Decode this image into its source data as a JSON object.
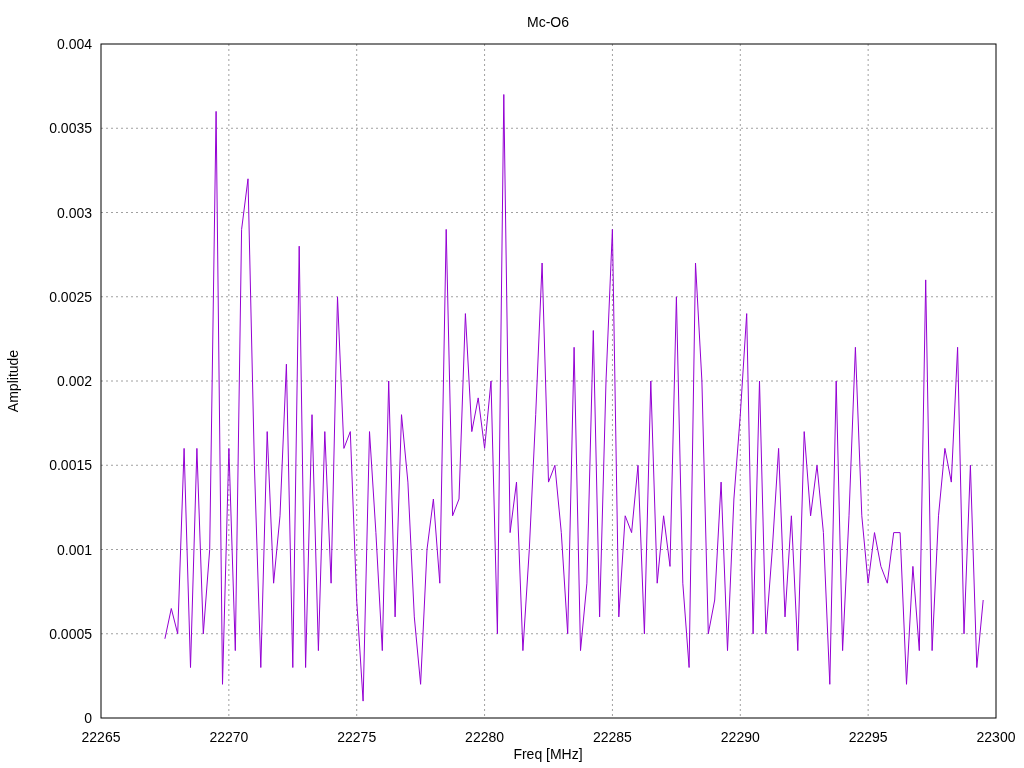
{
  "chart_data": {
    "type": "line",
    "title": "Mc-O6",
    "xlabel": "Freq [MHz]",
    "ylabel": "Amplitude",
    "xlim": [
      22265,
      22300
    ],
    "ylim": [
      0,
      0.004
    ],
    "xticks": [
      22265,
      22270,
      22275,
      22280,
      22285,
      22290,
      22295,
      22300
    ],
    "yticks": [
      {
        "value": 0,
        "label": "0"
      },
      {
        "value": 0.0005,
        "label": "0.0005"
      },
      {
        "value": 0.001,
        "label": "0.001"
      },
      {
        "value": 0.0015,
        "label": "0.0015"
      },
      {
        "value": 0.002,
        "label": "0.002"
      },
      {
        "value": 0.0025,
        "label": "0.0025"
      },
      {
        "value": 0.003,
        "label": "0.003"
      },
      {
        "value": 0.0035,
        "label": "0.0035"
      },
      {
        "value": 0.004,
        "label": "0.004"
      }
    ],
    "x": [
      22267.5,
      22267.75,
      22268,
      22268.25,
      22268.5,
      22268.75,
      22269,
      22269.25,
      22269.5,
      22269.75,
      22270,
      22270.25,
      22270.5,
      22270.75,
      22271,
      22271.25,
      22271.5,
      22271.75,
      22272,
      22272.25,
      22272.5,
      22272.75,
      22273,
      22273.25,
      22273.5,
      22273.75,
      22274,
      22274.25,
      22274.5,
      22274.75,
      22275,
      22275.25,
      22275.5,
      22275.75,
      22276,
      22276.25,
      22276.5,
      22276.75,
      22277,
      22277.25,
      22277.5,
      22277.75,
      22278,
      22278.25,
      22278.5,
      22278.75,
      22279,
      22279.25,
      22279.5,
      22279.75,
      22280,
      22280.25,
      22280.5,
      22280.75,
      22281,
      22281.25,
      22281.5,
      22281.75,
      22282,
      22282.25,
      22282.5,
      22282.75,
      22283,
      22283.25,
      22283.5,
      22283.75,
      22284,
      22284.25,
      22284.5,
      22284.75,
      22285,
      22285.25,
      22285.5,
      22285.75,
      22286,
      22286.25,
      22286.5,
      22286.75,
      22287,
      22287.25,
      22287.5,
      22287.75,
      22288,
      22288.25,
      22288.5,
      22288.75,
      22289,
      22289.25,
      22289.5,
      22289.75,
      22290,
      22290.25,
      22290.5,
      22290.75,
      22291,
      22291.25,
      22291.5,
      22291.75,
      22292,
      22292.25,
      22292.5,
      22292.75,
      22293,
      22293.25,
      22293.5,
      22293.75,
      22294,
      22294.25,
      22294.5,
      22294.75,
      22295,
      22295.25,
      22295.5,
      22295.75,
      22296,
      22296.25,
      22296.5,
      22296.75,
      22297,
      22297.25,
      22297.5,
      22297.75,
      22298,
      22298.25,
      22298.5,
      22298.75,
      22299,
      22299.25,
      22299.5
    ],
    "grid": true,
    "series": [
      {
        "color": "#9400d3",
        "values": [
          0.00047,
          0.00065,
          0.0005,
          0.0016,
          0.0003,
          0.0016,
          0.0005,
          0.001,
          0.0036,
          0.0002,
          0.0016,
          0.0004,
          0.0029,
          0.0032,
          0.0015,
          0.0003,
          0.0017,
          0.0008,
          0.0012,
          0.0021,
          0.0003,
          0.0028,
          0.0003,
          0.0018,
          0.0004,
          0.0017,
          0.0008,
          0.0025,
          0.0016,
          0.0017,
          0.0007,
          0.0001,
          0.0017,
          0.0011,
          0.0004,
          0.002,
          0.0006,
          0.0018,
          0.0014,
          0.0006,
          0.0002,
          0.001,
          0.0013,
          0.0008,
          0.0029,
          0.0012,
          0.0013,
          0.0024,
          0.0017,
          0.0019,
          0.0016,
          0.002,
          0.0005,
          0.0037,
          0.0011,
          0.0014,
          0.0004,
          0.001,
          0.0018,
          0.0027,
          0.0014,
          0.0015,
          0.0011,
          0.0005,
          0.0022,
          0.0004,
          0.0008,
          0.0023,
          0.0006,
          0.002,
          0.0029,
          0.0006,
          0.0012,
          0.0011,
          0.0015,
          0.0005,
          0.002,
          0.0008,
          0.0012,
          0.0009,
          0.0025,
          0.0008,
          0.0003,
          0.0027,
          0.002,
          0.0005,
          0.0007,
          0.0014,
          0.0004,
          0.0013,
          0.0018,
          0.0024,
          0.0005,
          0.002,
          0.0005,
          0.001,
          0.0016,
          0.0006,
          0.0012,
          0.0004,
          0.0017,
          0.0012,
          0.0015,
          0.0011,
          0.0002,
          0.002,
          0.0004,
          0.0012,
          0.0022,
          0.0012,
          0.0008,
          0.0011,
          0.0009,
          0.0008,
          0.0011,
          0.0011,
          0.0002,
          0.0009,
          0.0004,
          0.0026,
          0.0004,
          0.0012,
          0.0016,
          0.0014,
          0.0022,
          0.0005,
          0.0015,
          0.0003,
          0.0007
        ]
      }
    ]
  }
}
